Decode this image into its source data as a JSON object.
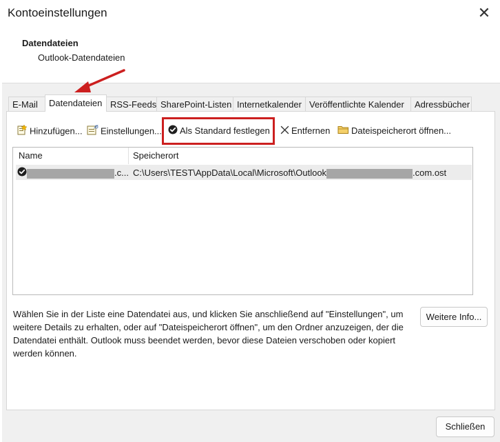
{
  "window": {
    "title": "Kontoeinstellungen",
    "close_glyph": "✕"
  },
  "header": {
    "title": "Datendateien",
    "subtitle": "Outlook-Datendateien"
  },
  "tabs": [
    {
      "label": "E-Mail",
      "active": false
    },
    {
      "label": "Datendateien",
      "active": true
    },
    {
      "label": "RSS-Feeds",
      "active": false
    },
    {
      "label": "SharePoint-Listen",
      "active": false
    },
    {
      "label": "Internetkalender",
      "active": false
    },
    {
      "label": "Veröffentlichte Kalender",
      "active": false
    },
    {
      "label": "Adressbücher",
      "active": false
    }
  ],
  "toolbar": {
    "add_label": "Hinzufügen...",
    "settings_label": "Einstellungen...",
    "set_default_label": "Als Standard festlegen",
    "remove_label": "Entfernen",
    "open_location_label": "Dateispeicherort öffnen..."
  },
  "list": {
    "columns": [
      "Name",
      "Speicherort"
    ],
    "rows": [
      {
        "name_suffix": ".c...",
        "location_prefix": "C:\\Users\\TEST\\AppData\\Local\\Microsoft\\Outlook",
        "location_suffix": ".com.ost"
      }
    ]
  },
  "description": "Wählen Sie in der Liste eine Datendatei aus, und klicken Sie anschließend auf \"Einstellungen\", um weitere Details zu erhalten, oder auf \"Dateispeicherort öffnen\", um den Ordner anzuzeigen, der die Datendatei enthält. Outlook muss beendet werden, bevor diese Dateien verschoben oder kopiert werden können.",
  "buttons": {
    "more_info": "Weitere Info...",
    "close": "Schließen"
  },
  "colors": {
    "annotation_red": "#cc1f1f",
    "folder_yellow": "#e8b923"
  }
}
